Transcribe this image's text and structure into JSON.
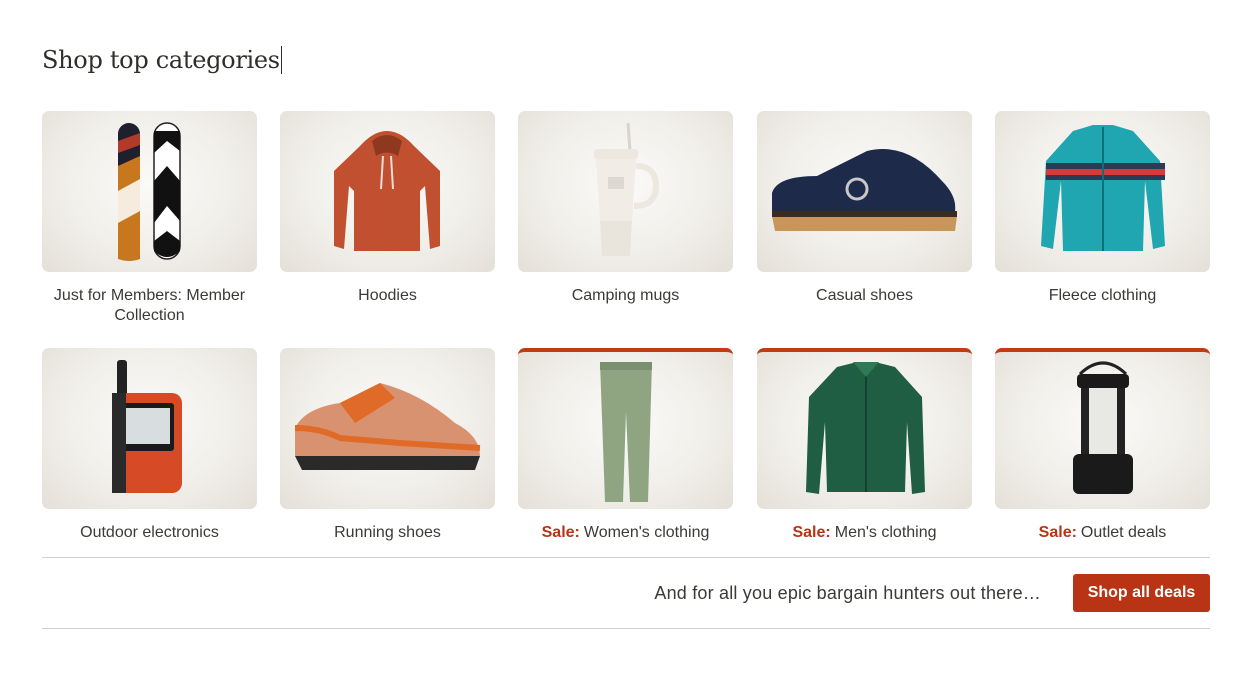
{
  "heading": "Shop top categories",
  "categories": [
    {
      "label": "Just for Members: Member Collection",
      "sale": false,
      "image": "snowboard-image"
    },
    {
      "label": "Hoodies",
      "sale": false,
      "image": "hoodie-image"
    },
    {
      "label": "Camping mugs",
      "sale": false,
      "image": "mug-image"
    },
    {
      "label": "Casual shoes",
      "sale": false,
      "image": "clog-image"
    },
    {
      "label": "Fleece clothing",
      "sale": false,
      "image": "fleece-jacket-image"
    },
    {
      "label": "Outdoor electronics",
      "sale": false,
      "image": "gps-device-image"
    },
    {
      "label": "Running shoes",
      "sale": false,
      "image": "running-shoe-image"
    },
    {
      "sale_prefix": "Sale:",
      "label": "Women's clothing",
      "sale": true,
      "image": "leggings-image"
    },
    {
      "sale_prefix": "Sale:",
      "label": "Men's clothing",
      "sale": true,
      "image": "jacket-image"
    },
    {
      "sale_prefix": "Sale:",
      "label": "Outlet deals",
      "sale": true,
      "image": "lantern-image"
    }
  ],
  "promo": {
    "text": "And for all you epic bargain hunters out there…",
    "button_label": "Shop all deals"
  },
  "colors": {
    "sale_accent": "#b93414",
    "button_bg": "#b93414",
    "text": "#2e2e2b"
  }
}
